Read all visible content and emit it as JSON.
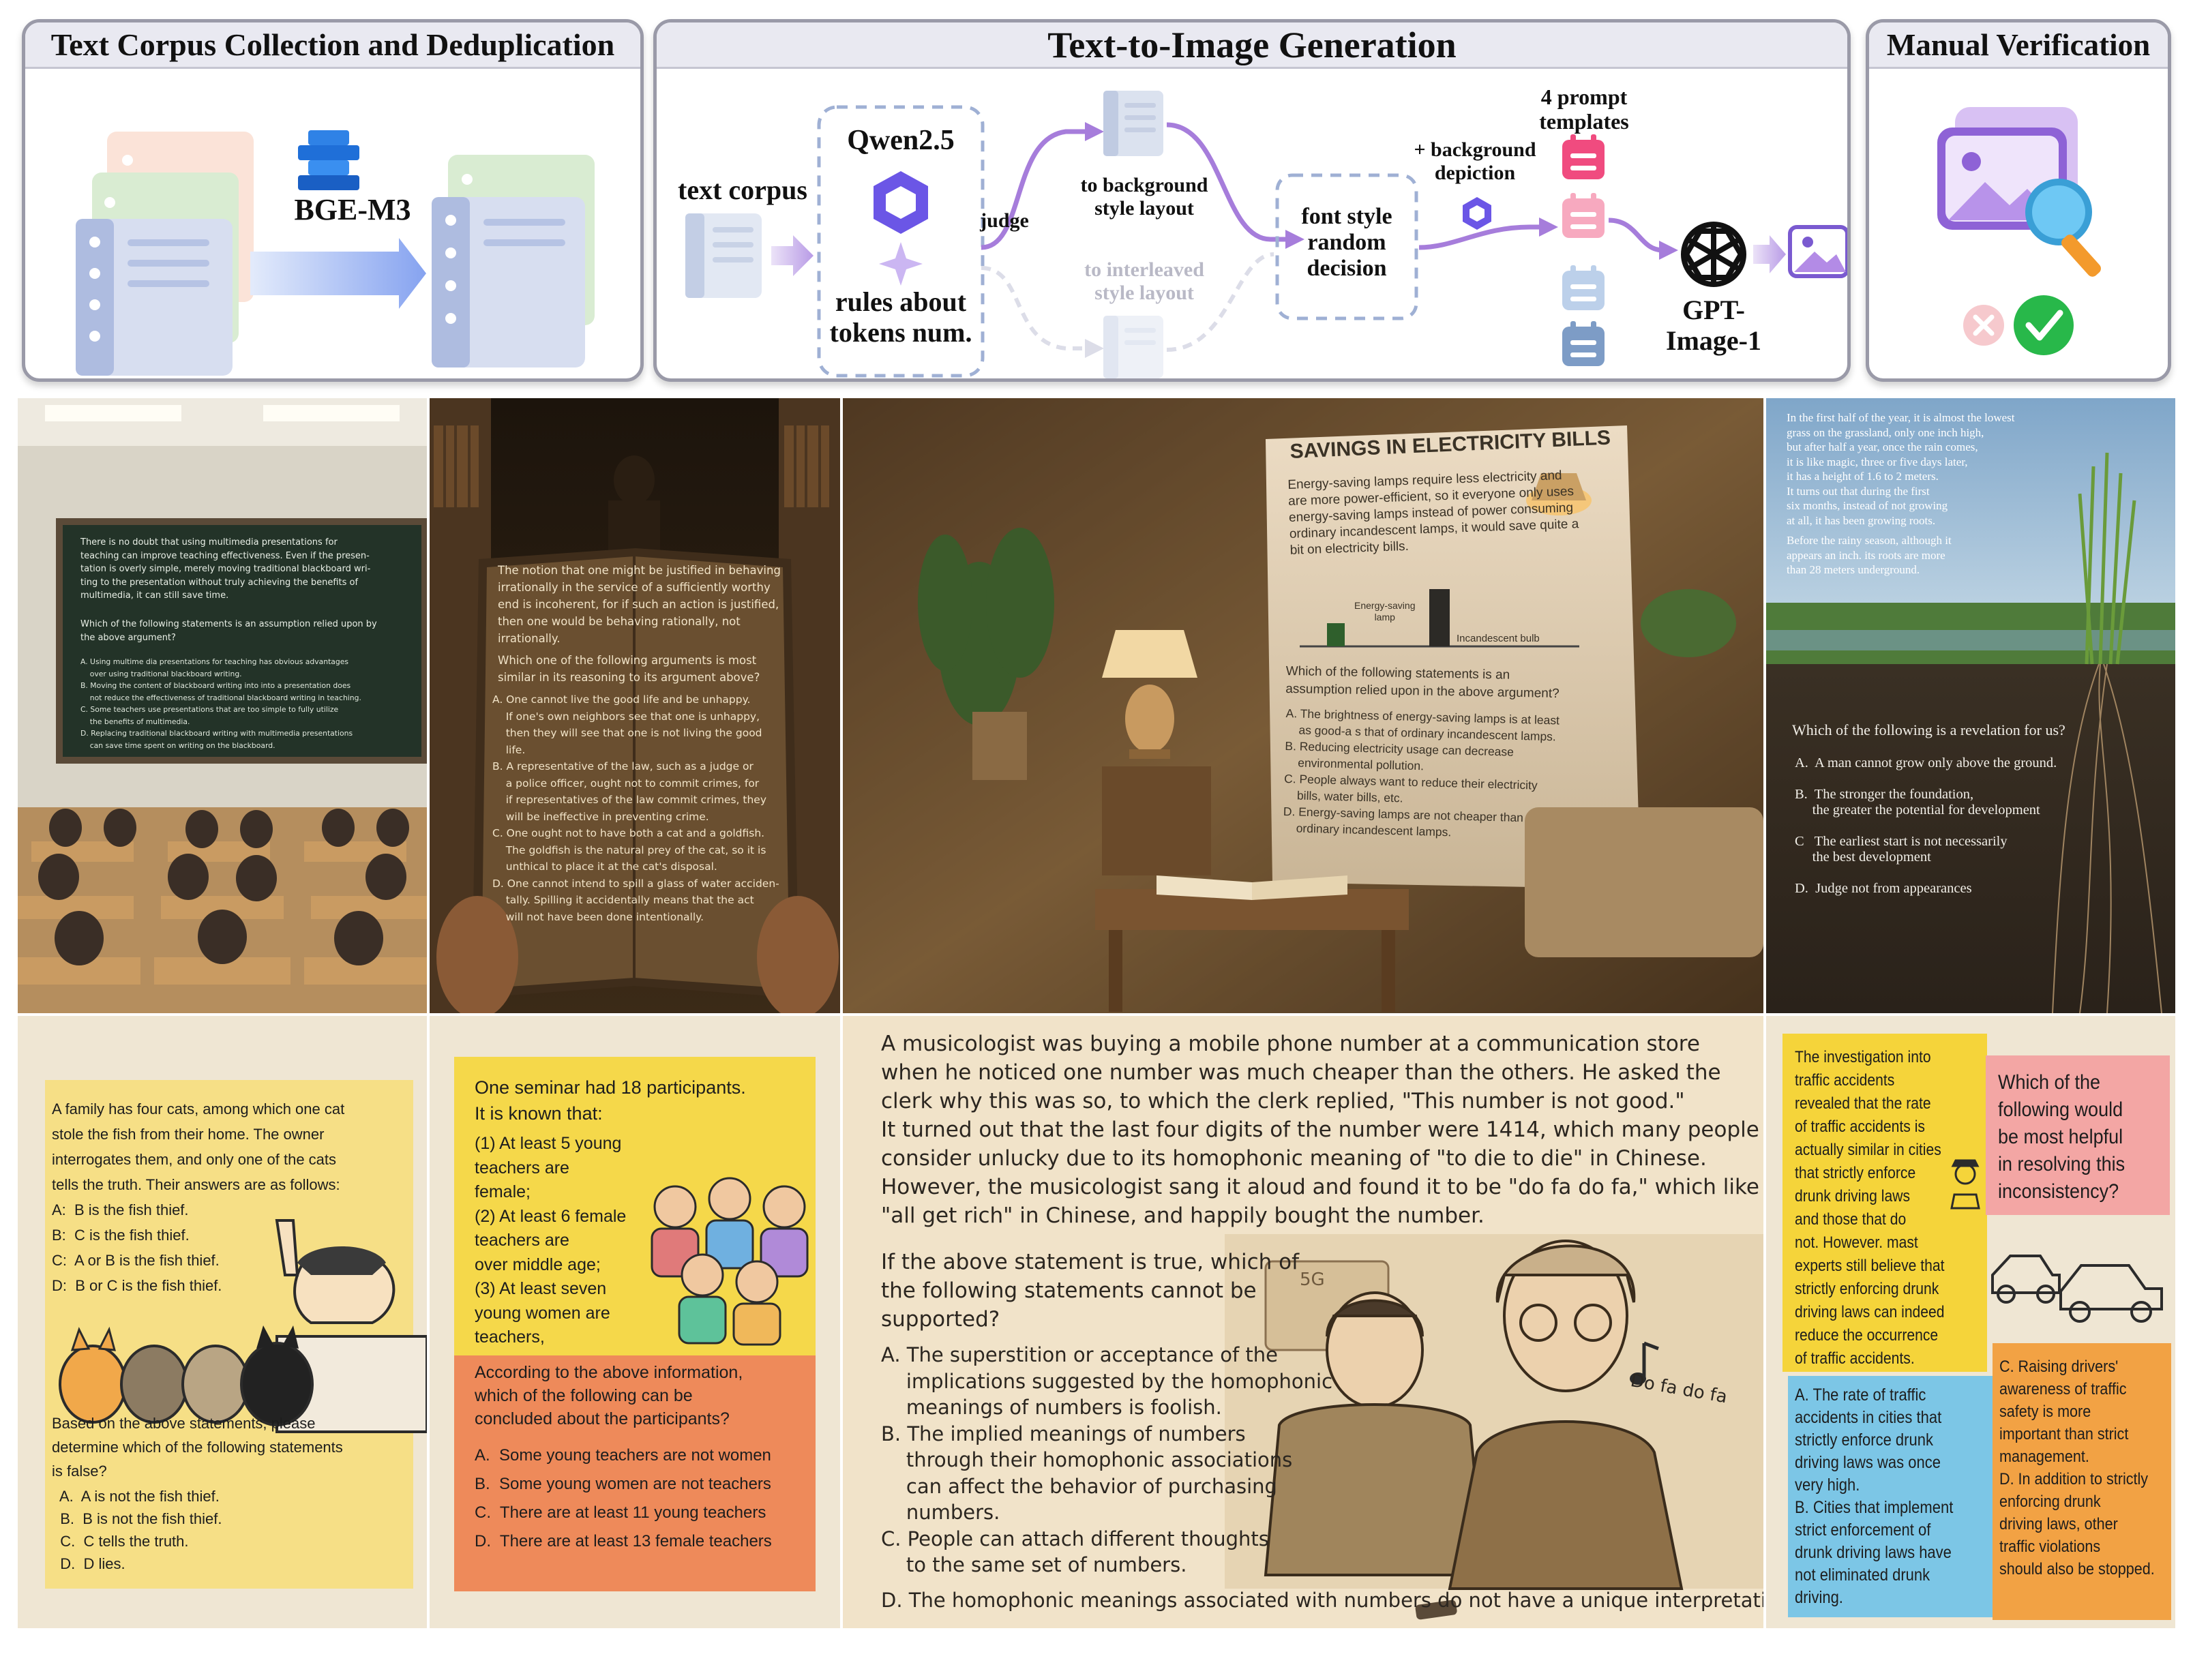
{
  "pipeline": {
    "panel1": {
      "title": "Text Corpus Collection and Deduplication",
      "model_label": "BGE-M3"
    },
    "panel2": {
      "title": "Text-to-Image Generation",
      "text_corpus": "text corpus",
      "qwen": "Qwen2.5",
      "rules": "rules about\ntokens num.",
      "judge": "judge",
      "to_background": "to background\nstyle layout",
      "to_interleaved": "to interleaved\nstyle layout",
      "font_decision": "font style\nrandom\ndecision",
      "bg_depiction": "+ background\ndepiction",
      "templates": "4 prompt\ntemplates",
      "gpt": "GPT-\nImage-1"
    },
    "panel3": {
      "title": "Manual Verification"
    }
  },
  "examples": {
    "classroom": {
      "passage": "There is no doubt that using multimedia presentations for\nteaching can improve teaching effectiveness. Even if the presen-\ntation is overly simple, merely moving traditional blackboard wri-\nting to the presentation without truly achieving the benefits of\nmultimedia, it can still save time.",
      "question": "Which of the following statements is an assumption relied upon by\nthe above argument?",
      "options": "A. Using multime dia presentations for teaching has obvious advantages\n    over using traditional blackboard writing.\nB. Moving the content of blackboard writing into into a presentation does\n    not reduce the effectiveness of traditional blackboard writing in teaching.\nC. Some teachers use presentations that are too simple to fully utilize\n    the benefits of multimedia.\nD. Replacing traditional blackboard writing with multimedia presentations\n    can save time spent on writing on the blackboard."
    },
    "book": {
      "passage": "The notion that one might be justified in behaving\nirrationally in the service of a sufficiently worthy\nend is incoherent, for if such an action is justified,\nthen one would be behaving rationally, not\nirrationally.",
      "question": "Which one of the following arguments is most\nsimilar in its reasoning to its argument above?",
      "options": "A. One cannot live the good life and be unhappy.\n    If one's own neighbors see that one is unhappy,\n    then they will see that one is not living the good\n    life.\nB. A representative of the law, such as a judge or\n    a police officer, ought not to commit crimes, for\n    if representatives of the law commit crimes, they\n    will be ineffective in preventing crime.\nC. One ought not to have both a cat and a goldfish.\n    The goldfish is the natural prey of the cat, so it is\n    unthical to place it at the cat's disposal.\nD. One cannot intend to spill a glass of water acciden-\n    tally. Spilling it accidentally means that the act\n    will not have been done intentionally."
    },
    "savings": {
      "title": "SAVINGS IN ELECTRICITY BILLS",
      "passage": "Energy-saving lamps require less electricity and\nare more power-efficient, so it everyone only uses\nenergy-saving lamps instead of power consuming\nordinary incandescent lamps, it would save quite a\nbit on electricity bills.",
      "bar1": "Energy-saving\nlamp",
      "bar2": "Incandescent bulb",
      "question": "Which of the following statements is an\nassumption relied upon in the above argument?",
      "options": "A. The brightness of energy-saving lamps is at least\n    as good-a s that of ordinary incandescent lamps.\nB. Reducing electricity usage can decrease\n    environmental pollution.\nC. People always want to reduce their electricity\n    bills, water bills, etc.\nD. Energy-saving lamps are not cheaper than\n    ordinary incandescent lamps."
    },
    "grass": {
      "passage1": "In the first half of the year, it is almost the lowest\ngrass on the grassland, only one inch high,\nbut after half a year, once the rain comes,\nit is like magic, three or five days later,\nit has a height of 1.6 to 2 meters.\nIt turns out that during the first\nsix months, instead of not growing\nat all, it has been growing roots.",
      "passage2": "Before the rainy season, although it\nappears an inch. its roots are more\nthan 28 meters underground.",
      "question": "Which of the following is a revelation for us?",
      "options": "A.  A man cannot grow only above the ground.\n\nB.  The stronger the foundation,\n     the greater the potential for development\n\nC   The earliest start is not necessarily\n     the best development\n\nD.  Judge not from appearances"
    },
    "cats": {
      "passage": "A family has four cats, among which one cat\nstole the fish from their home. The owner\ninterrogates them, and only one of the cats\ntells the truth. Their answers are as follows:\nA:  B is the fish thief.\nB:  C is the fish thief.\nC:  A or B is the fish thief.\nD:  B or C is the fish thief.",
      "question": "Based on the above statements, please\ndetermine which of the following statements\nis false?",
      "options": "  A.  A is not the fish thief.\n  B.  B is not the fish thief.\n  C.  C tells the truth.\n  D.  D lies."
    },
    "seminar": {
      "intro": "One seminar had 18 participants.\nIt is known that:",
      "facts": "(1) At least 5 young\nteachers are\nfemale;\n(2) At least 6 female\nteachers are\nover middle age;\n(3) At least seven\nyoung women are\nteachers,",
      "question": "According to the above information,\nwhich of the following can be\nconcluded about the participants?",
      "options": "A.  Some young teachers are not women\nB.  Some young women are not teachers\nC.  There are at least 11 young teachers\nD.  There are at least 13 female teachers"
    },
    "musicologist": {
      "passage": "A musicologist was buying a mobile phone number at a communication store\nwhen he noticed one number was much cheaper than the others. He asked the\nclerk why this was so, to which the clerk replied, \"This number is not good.\"\nIt turned out that the last four digits of the number were 1414, which many people\nconsider unlucky due to its homophonic meaning of \"to die to die\" in Chinese.\nHowever, the musicologist sang it aloud and found it to be \"do fa do fa,\" which like\n\"all get rich\" in Chinese, and happily bought the number.",
      "question": "If the above statement is true, which of\nthe following statements cannot be\nsupported?",
      "options": "A. The superstition or acceptance of the\n    implications suggested by the homophonic\n    meanings of numbers is foolish.\nB. The implied meanings of numbers\n    through their homophonic associations\n    can affect the behavior of purchasing\n    numbers.\nC. People can attach different thoughts\n    to the same set of numbers.",
      "option_d": "D. The homophonic meanings associated with numbers do not have a unique interpretation.",
      "sign": "5G",
      "sung": "Do fa do fa"
    },
    "traffic": {
      "note1": "The investigation into\ntraffic accidents\nrevealed that the rate\nof traffic accidents is\nactually similar in cities\nthat strictly enforce\ndrunk driving laws\nand those that do\nnot. However. mast\nexperts still believe that\nstrictly enforcing drunk\ndriving laws can indeed\nreduce the occurrence\nof traffic accidents.",
      "note2": "Which of the\nfollowing would\nbe most helpful\nin resolving this\ninconsistency?",
      "note3": "A. The rate of traffic\naccidents in cities that\nstrictly enforce drunk\ndriving laws was once\nvery high.\nB. Cities that implement\nstrict enforcement of\ndrunk driving laws have\nnot eliminated drunk\ndriving.",
      "note4": "C. Raising drivers'\nawareness of traffic\nsafety is more\nimportant than strict\nmanagement.\nD. In addition to strictly\nenforcing drunk\ndriving laws, other\ntraffic violations\nshould also be stopped."
    }
  }
}
